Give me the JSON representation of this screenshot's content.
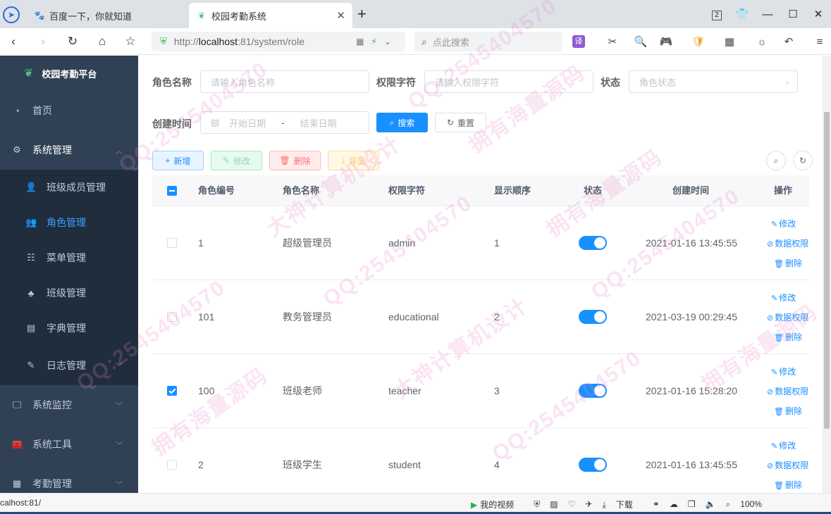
{
  "browser": {
    "tabs": [
      {
        "label": "百度一下，你就知道"
      },
      {
        "label": "校园考勤系统"
      }
    ],
    "window_badge": "2",
    "address": {
      "prefix": "http://",
      "host": "localhost",
      "path": ":81/system/role"
    },
    "search_placeholder": "点此搜索",
    "ext_translate": "译"
  },
  "sidebar": {
    "brand": "校园考勤平台",
    "home": "首页",
    "system_management": "系统管理",
    "sub_items": [
      "班级成员管理",
      "角色管理",
      "菜单管理",
      "班级管理",
      "字典管理",
      "日志管理"
    ],
    "monitor": "系统监控",
    "tools": "系统工具",
    "attendance": "考勤管理"
  },
  "filters": {
    "role_name_label": "角色名称",
    "role_name_placeholder": "请输入角色名称",
    "role_key_label": "权限字符",
    "role_key_placeholder": "请输入权限字符",
    "status_label": "状态",
    "status_placeholder": "角色状态",
    "created_label": "创建时间",
    "start_placeholder": "开始日期",
    "range_sep": "-",
    "end_placeholder": "结束日期",
    "search_btn": "搜索",
    "reset_btn": "重置"
  },
  "toolbar": {
    "add": "新增",
    "edit": "修改",
    "delete": "删除",
    "export": "导出"
  },
  "table": {
    "headers": [
      "角色编号",
      "角色名称",
      "权限字符",
      "显示顺序",
      "状态",
      "创建时间",
      "操作"
    ],
    "rows": [
      {
        "id": "1",
        "name": "超级管理员",
        "key": "admin",
        "sort": "1",
        "status_on": true,
        "created": "2021-01-16 13:45:55",
        "checked": false
      },
      {
        "id": "101",
        "name": "教务管理员",
        "key": "educational",
        "sort": "2",
        "status_on": true,
        "created": "2021-03-19 00:29:45",
        "checked": false
      },
      {
        "id": "100",
        "name": "班级老师",
        "key": "teacher",
        "sort": "3",
        "status_on": true,
        "created": "2021-01-16 15:28:20",
        "checked": true
      },
      {
        "id": "2",
        "name": "班级学生",
        "key": "student",
        "sort": "4",
        "status_on": true,
        "created": "2021-01-16 13:45:55",
        "checked": false
      }
    ],
    "op_edit": "修改",
    "op_data_scope": "数据权限",
    "op_delete": "删除"
  },
  "statusbar": {
    "url": "calhost:81/",
    "my_video": "我的视频",
    "download": "下载",
    "zoom": "100%"
  },
  "watermark": {
    "qq": "QQ:2545404570",
    "line1": "大神计算机设计",
    "line2": "拥有海量源码"
  },
  "colors": {
    "primary": "#1890ff",
    "sidebar_bg": "#304156",
    "submenu_bg": "#1f2d3d"
  }
}
